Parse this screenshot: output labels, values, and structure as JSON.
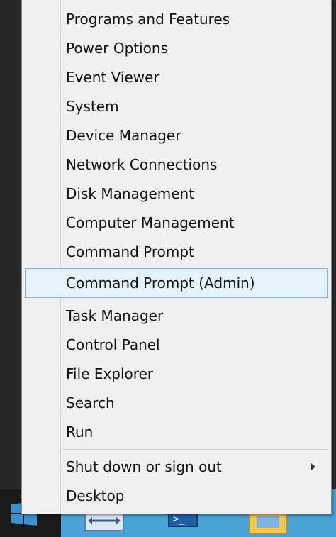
{
  "menu": {
    "items": [
      {
        "label": "Programs and Features"
      },
      {
        "label": "Power Options"
      },
      {
        "label": "Event Viewer"
      },
      {
        "label": "System"
      },
      {
        "label": "Device Manager"
      },
      {
        "label": "Network Connections"
      },
      {
        "label": "Disk Management"
      },
      {
        "label": "Computer Management"
      },
      {
        "label": "Command Prompt"
      },
      {
        "label": "Command Prompt (Admin)"
      },
      {
        "label": "Task Manager"
      },
      {
        "label": "Control Panel"
      },
      {
        "label": "File Explorer"
      },
      {
        "label": "Search"
      },
      {
        "label": "Run"
      },
      {
        "label": "Shut down or sign out"
      },
      {
        "label": "Desktop"
      }
    ],
    "highlighted_item": "Command Prompt (Admin)"
  },
  "taskbar": {
    "start_icon": "windows-logo-icon",
    "apps": [
      "server-manager-icon",
      "powershell-icon",
      "file-explorer-icon"
    ]
  },
  "colors": {
    "taskbar": "#4aa3d6",
    "menu_background": "#f0f0f0",
    "highlight_background": "#e5f1fb",
    "highlight_border": "#7fb6e6"
  }
}
